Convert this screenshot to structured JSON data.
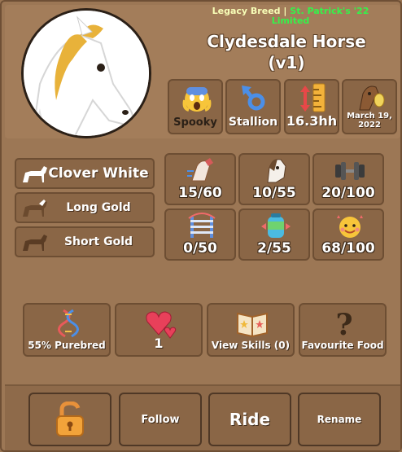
{
  "header": {
    "breed_tag": "Legacy Breed",
    "separator": "|",
    "event_tag": "St. Patrick's '22 Limited",
    "name": "Clydesdale Horse",
    "version": "(v1)"
  },
  "info": {
    "personality": "Spooky",
    "gender": "Stallion",
    "height": "16.3hh",
    "birthday_line1": "March 19,",
    "birthday_line2": "2022"
  },
  "coat": {
    "primary": "Clover White",
    "secondary": "Long Gold",
    "tertiary": "Short Gold"
  },
  "stats": [
    {
      "value": "15/60",
      "icon": "speed-icon"
    },
    {
      "value": "10/55",
      "icon": "horse-head-icon"
    },
    {
      "value": "20/100",
      "icon": "dumbbell-icon"
    },
    {
      "value": "0/50",
      "icon": "jump-icon"
    },
    {
      "value": "2/55",
      "icon": "stamina-icon"
    },
    {
      "value": "68/100",
      "icon": "happiness-icon"
    }
  ],
  "actions": {
    "purebred": "55% Purebred",
    "likes": "1",
    "skills": "View Skills (0)",
    "food": "Favourite Food"
  },
  "buttons": {
    "follow": "Follow",
    "ride": "Ride",
    "rename": "Rename"
  },
  "colors": {
    "panel": "#9c7755",
    "tile": "#8a6646",
    "breed_text": "#f8ffb8",
    "event_text": "#35f24a"
  }
}
